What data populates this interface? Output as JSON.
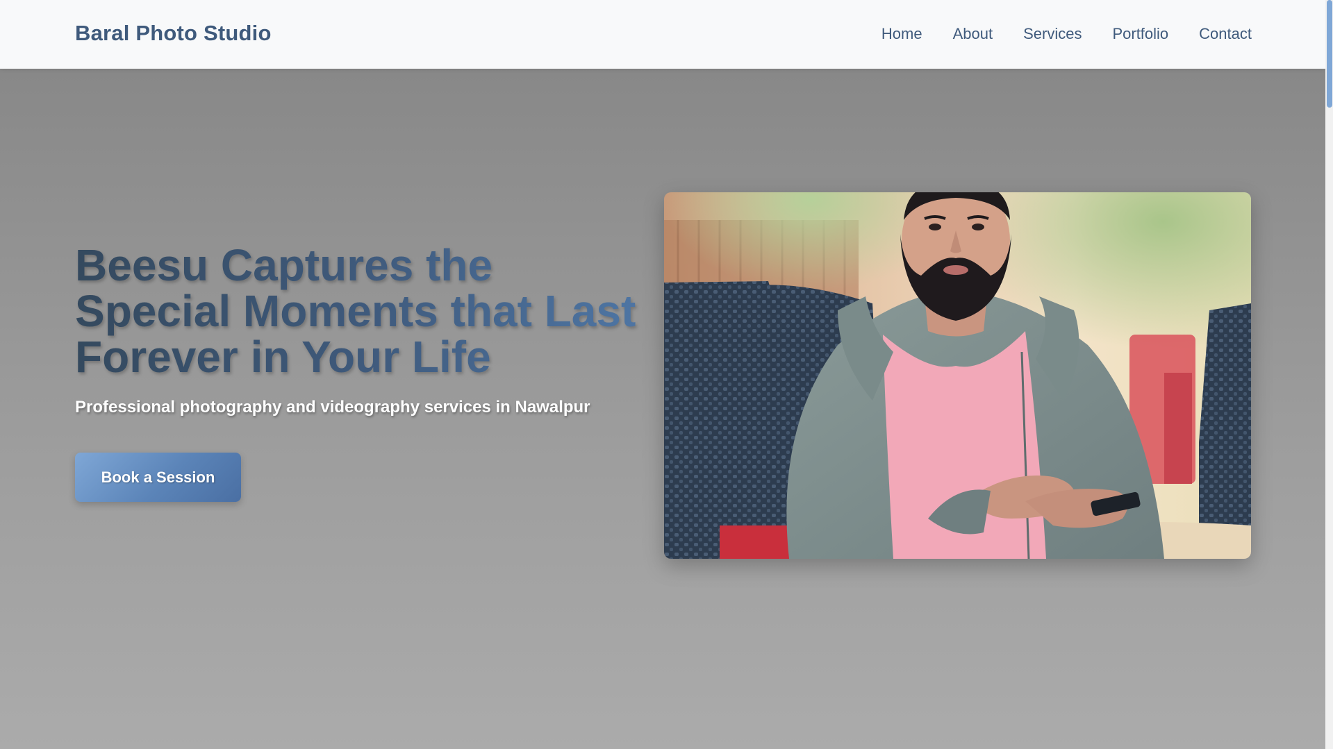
{
  "navbar": {
    "brand": "Baral Photo Studio",
    "links": [
      "Home",
      "About",
      "Services",
      "Portfolio",
      "Contact"
    ]
  },
  "hero": {
    "title": "Beesu Captures the Special Moments that Last Forever in Your Life",
    "subtitle": "Professional photography and videography services in Nawalpur",
    "cta_label": "Book a Session",
    "photo_icon": "portrait-photo"
  },
  "colors": {
    "brand": "#3f5a7c",
    "accent": "#5b84b8",
    "nav_background": "#f8f9fa",
    "hero_background": "#9b9b9b"
  }
}
